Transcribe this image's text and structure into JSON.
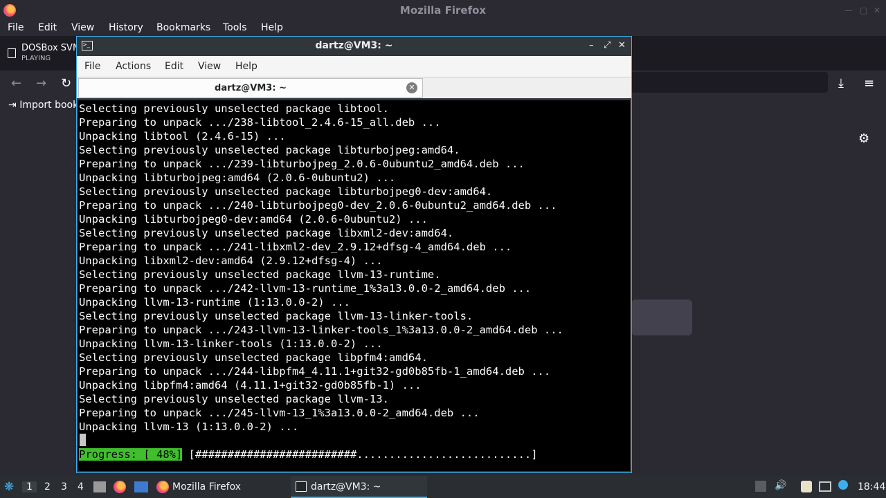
{
  "firefox": {
    "window_title": "Mozilla Firefox",
    "menu": [
      "File",
      "Edit",
      "View",
      "History",
      "Bookmarks",
      "Tools",
      "Help"
    ],
    "tab": {
      "title": "DOSBox SVN",
      "status": "PLAYING"
    },
    "bookmark_import": "Import book"
  },
  "terminal": {
    "title": "dartz@VM3: ~",
    "menu": [
      "File",
      "Actions",
      "Edit",
      "View",
      "Help"
    ],
    "tab_label": "dartz@VM3: ~",
    "lines": [
      "Selecting previously unselected package libtool.",
      "Preparing to unpack .../238-libtool_2.4.6-15_all.deb ...",
      "Unpacking libtool (2.4.6-15) ...",
      "Selecting previously unselected package libturbojpeg:amd64.",
      "Preparing to unpack .../239-libturbojpeg_2.0.6-0ubuntu2_amd64.deb ...",
      "Unpacking libturbojpeg:amd64 (2.0.6-0ubuntu2) ...",
      "Selecting previously unselected package libturbojpeg0-dev:amd64.",
      "Preparing to unpack .../240-libturbojpeg0-dev_2.0.6-0ubuntu2_amd64.deb ...",
      "Unpacking libturbojpeg0-dev:amd64 (2.0.6-0ubuntu2) ...",
      "Selecting previously unselected package libxml2-dev:amd64.",
      "Preparing to unpack .../241-libxml2-dev_2.9.12+dfsg-4_amd64.deb ...",
      "Unpacking libxml2-dev:amd64 (2.9.12+dfsg-4) ...",
      "Selecting previously unselected package llvm-13-runtime.",
      "Preparing to unpack .../242-llvm-13-runtime_1%3a13.0.0-2_amd64.deb ...",
      "Unpacking llvm-13-runtime (1:13.0.0-2) ...",
      "Selecting previously unselected package llvm-13-linker-tools.",
      "Preparing to unpack .../243-llvm-13-linker-tools_1%3a13.0.0-2_amd64.deb ...",
      "Unpacking llvm-13-linker-tools (1:13.0.0-2) ...",
      "Selecting previously unselected package libpfm4:amd64.",
      "Preparing to unpack .../244-libpfm4_4.11.1+git32-gd0b85fb-1_amd64.deb ...",
      "Unpacking libpfm4:amd64 (4.11.1+git32-gd0b85fb-1) ...",
      "Selecting previously unselected package llvm-13.",
      "Preparing to unpack .../245-llvm-13_1%3a13.0.0-2_amd64.deb ...",
      "Unpacking llvm-13 (1:13.0.0-2) ..."
    ],
    "progress_label": "Progress: [ 48%]",
    "progress_bar": " [#########################...........................]",
    "progress_percent": 48
  },
  "panel": {
    "desktops": [
      "1",
      "2",
      "3",
      "4"
    ],
    "active_desktop": "1",
    "tasks": [
      {
        "label": "Mozilla Firefox",
        "icon": "firefox-icon"
      },
      {
        "label": "dartz@VM3: ~",
        "icon": "terminal-icon"
      }
    ],
    "clock": "18:44"
  },
  "colors": {
    "accent": "#3daee9",
    "progress": "#3fbf2c",
    "terminal_bg": "#000000"
  }
}
